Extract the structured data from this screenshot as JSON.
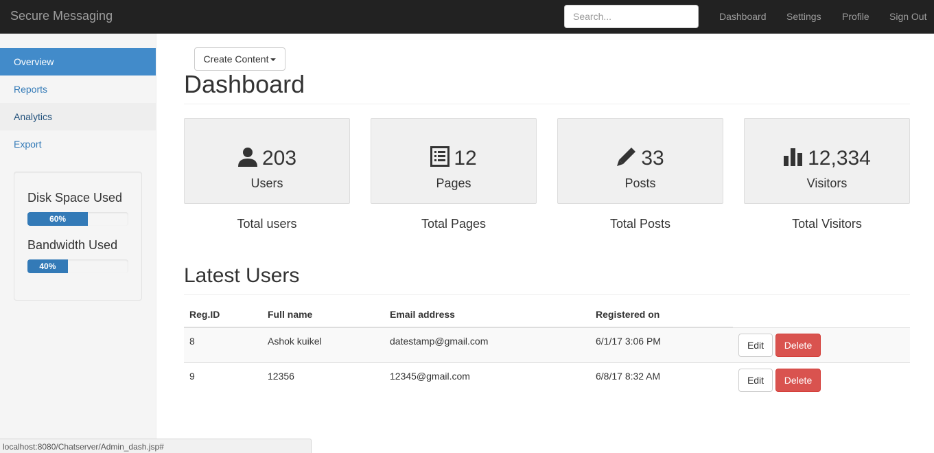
{
  "navbar": {
    "brand": "Secure Messaging",
    "search_placeholder": "Search...",
    "links": [
      "Dashboard",
      "Settings",
      "Profile",
      "Sign Out"
    ]
  },
  "sidebar": {
    "items": [
      {
        "label": "Overview",
        "state": "active"
      },
      {
        "label": "Reports",
        "state": "normal"
      },
      {
        "label": "Analytics",
        "state": "hover"
      },
      {
        "label": "Export",
        "state": "normal"
      }
    ],
    "usage": {
      "disk_title": "Disk Space Used",
      "disk_percent": 60,
      "disk_label": "60%",
      "bandwidth_title": "Bandwidth Used",
      "bandwidth_percent": 40,
      "bandwidth_label": "40%"
    }
  },
  "main": {
    "create_button": "Create Content",
    "title": "Dashboard",
    "stats": [
      {
        "icon": "user-icon",
        "value": "203",
        "label": "Users",
        "caption": "Total users"
      },
      {
        "icon": "list-icon",
        "value": "12",
        "label": "Pages",
        "caption": "Total Pages"
      },
      {
        "icon": "pencil-icon",
        "value": "33",
        "label": "Posts",
        "caption": "Total Posts"
      },
      {
        "icon": "bar-chart-icon",
        "value": "12,334",
        "label": "Visitors",
        "caption": "Total Visitors"
      }
    ],
    "latest_users": {
      "title": "Latest Users",
      "columns": [
        "Reg.ID",
        "Full name",
        "Email address",
        "Registered on"
      ],
      "rows": [
        {
          "id": "8",
          "name": "Ashok kuikel",
          "email": "datestamp@gmail.com",
          "registered": "6/1/17 3:06 PM"
        },
        {
          "id": "9",
          "name": "12356",
          "email": "12345@gmail.com",
          "registered": "6/8/17 8:32 AM"
        }
      ],
      "edit_label": "Edit",
      "delete_label": "Delete"
    }
  },
  "statusbar": "localhost:8080/Chatserver/Admin_dash.jsp#",
  "colors": {
    "navbar": "#222222",
    "accent": "#428bca",
    "progress": "#337ab7",
    "danger": "#d9534f"
  }
}
